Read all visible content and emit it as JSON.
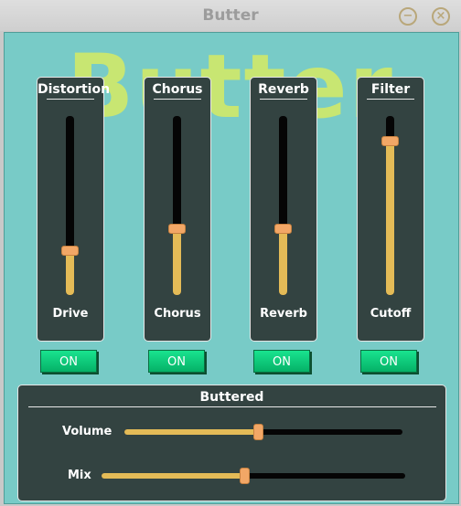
{
  "window": {
    "title": "Butter",
    "minimize_glyph": "−",
    "close_glyph": "×",
    "logo_text": "Butter"
  },
  "effects": [
    {
      "title": "Distortion",
      "param_label": "Drive",
      "value": 0.23,
      "button_label": "ON"
    },
    {
      "title": "Chorus",
      "param_label": "Chorus",
      "value": 0.36,
      "button_label": "ON"
    },
    {
      "title": "Reverb",
      "param_label": "Reverb",
      "value": 0.36,
      "button_label": "ON"
    },
    {
      "title": "Filter",
      "param_label": "Cutoff",
      "value": 0.88,
      "button_label": "ON"
    }
  ],
  "buttered": {
    "title": "Buttered",
    "sliders": [
      {
        "label": "Volume",
        "value": 0.48
      },
      {
        "label": "Mix",
        "value": 0.47
      }
    ]
  },
  "colors": {
    "background": "#78cbc7",
    "panel": "#334341",
    "fill": "#e4bb57",
    "handle": "#f2a766",
    "button": "#0bcf7c",
    "logo": "#c8e672"
  }
}
